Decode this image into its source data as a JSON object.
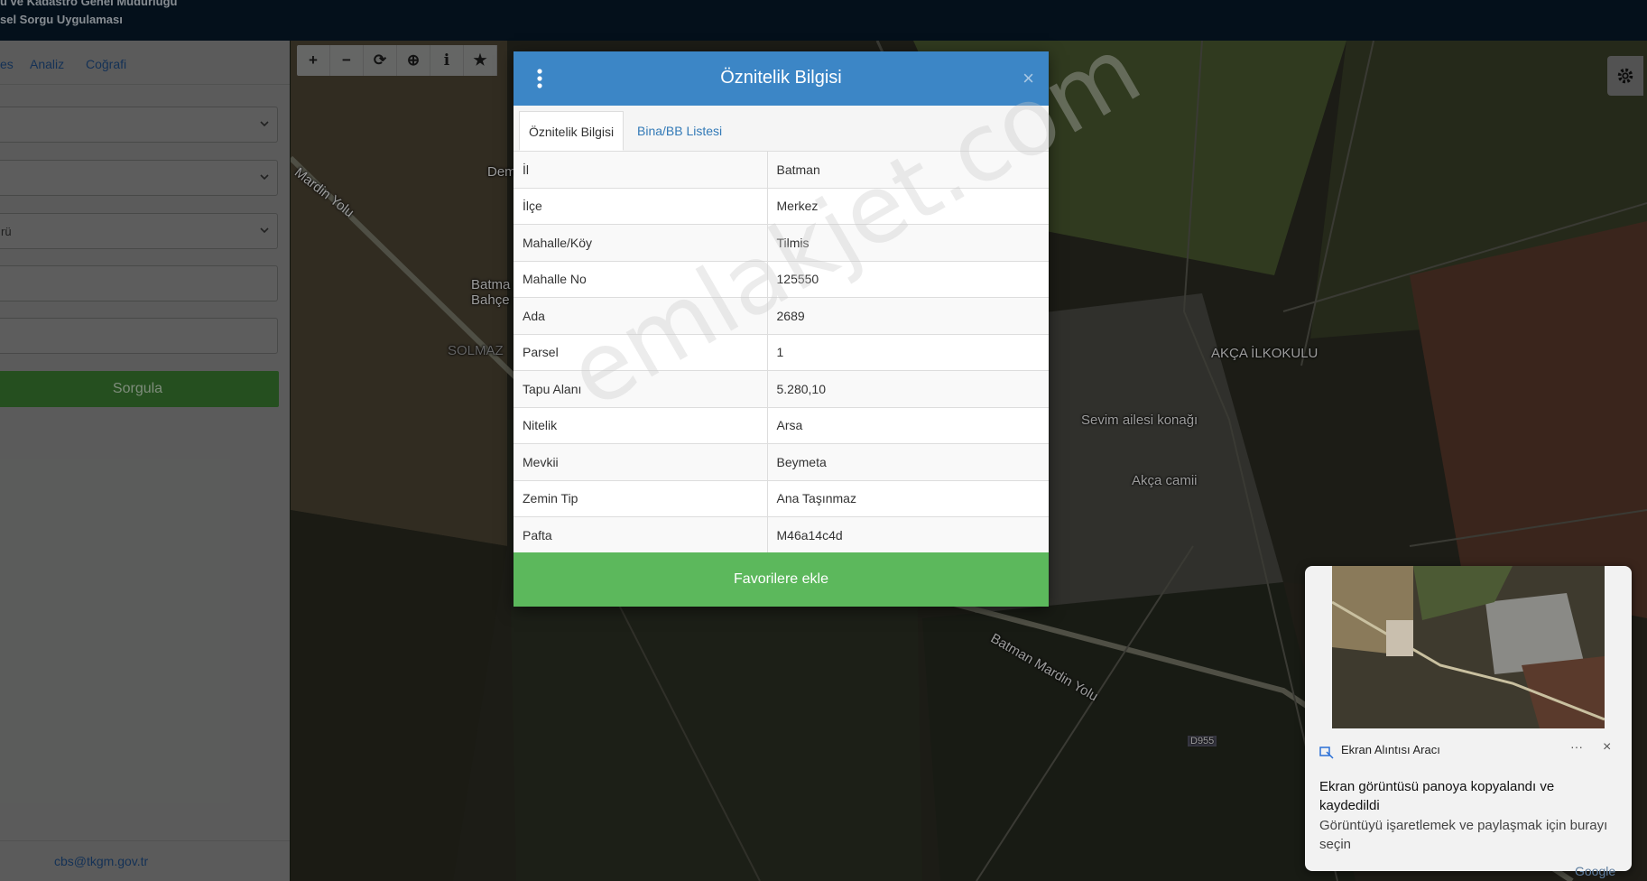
{
  "header": {
    "line1": "u ve Kadastro Genel Müdürlüğü",
    "line2": "sel Sorgu Uygulaması"
  },
  "sidebar": {
    "tabs": [
      {
        "label": "es"
      },
      {
        "label": "Analiz"
      },
      {
        "label": "Coğrafi"
      }
    ],
    "fields": [
      {
        "value": ""
      },
      {
        "value": ""
      },
      {
        "value": "rü"
      },
      {
        "value": ""
      },
      {
        "value": ""
      }
    ],
    "submit_label": "Sorgula",
    "footer_email": "cbs@tkgm.gov.tr"
  },
  "map": {
    "labels": [
      {
        "text": "Dem"
      },
      {
        "text": "Mardin Yolu"
      },
      {
        "text": "Batma"
      },
      {
        "text": "Bahçe"
      },
      {
        "text": "SOLMAZ"
      },
      {
        "text": "AKÇA İLKOKULU"
      },
      {
        "text": "Sevim ailesi konağı"
      },
      {
        "text": "Akça camii"
      },
      {
        "text": "Batman Mardin Yolu"
      },
      {
        "text": "D955"
      }
    ]
  },
  "toolbar": {
    "buttons": [
      {
        "icon": "zoom-in-icon"
      },
      {
        "icon": "zoom-out-icon"
      },
      {
        "icon": "refresh-icon"
      },
      {
        "icon": "locate-icon"
      },
      {
        "icon": "info-icon"
      },
      {
        "icon": "star-icon"
      }
    ]
  },
  "modal": {
    "title": "Öznitelik Bilgisi",
    "close": "×",
    "tabs": [
      {
        "label": "Öznitelik Bilgisi"
      },
      {
        "label": "Bina/BB Listesi"
      }
    ],
    "rows": [
      {
        "key": "İl",
        "value": "Batman"
      },
      {
        "key": "İlçe",
        "value": "Merkez"
      },
      {
        "key": "Mahalle/Köy",
        "value": "Tilmis"
      },
      {
        "key": "Mahalle No",
        "value": "125550"
      },
      {
        "key": "Ada",
        "value": "2689"
      },
      {
        "key": "Parsel",
        "value": "1"
      },
      {
        "key": "Tapu Alanı",
        "value": "5.280,10"
      },
      {
        "key": "Nitelik",
        "value": "Arsa"
      },
      {
        "key": "Mevkii",
        "value": "Beymeta"
      },
      {
        "key": "Zemin Tip",
        "value": "Ana Taşınmaz"
      },
      {
        "key": "Pafta",
        "value": "M46a14c4d"
      }
    ],
    "add_favorite_label": "Favorilere ekle"
  },
  "watermark": "emlakjet.com",
  "notification": {
    "app_name": "Ekran Alıntısı Aracı",
    "more": "···",
    "close": "×",
    "heading": "Ekran görüntüsü panoya kopyalandı ve kaydedildi",
    "body": "Görüntüyü işaretlemek ve paylaşmak için burayı seçin"
  },
  "attribution": "Google",
  "colors": {
    "modal_header": "#3c86c6",
    "success": "#5cb85c",
    "topbar": "#071a2a"
  }
}
